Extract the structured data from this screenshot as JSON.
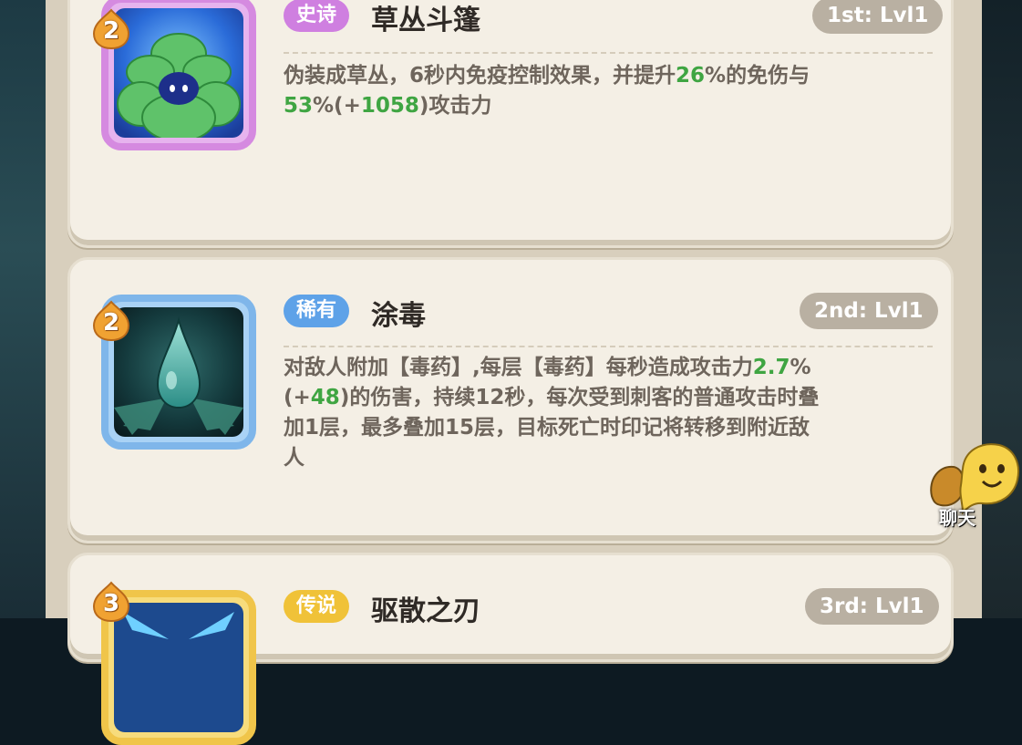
{
  "cards": [
    {
      "rarity": "史诗",
      "name": "草丛斗篷",
      "level_label": "1st: Lvl1",
      "badge": "2",
      "icon": "bush-cloak-icon",
      "desc_lines": [
        [
          {
            "t": "伪装成草丛，6秒内免疫控制效果，并提升"
          },
          {
            "t": "26",
            "g": true
          },
          {
            "t": "%的免伤与"
          }
        ],
        [
          {
            "t": "53",
            "g": true
          },
          {
            "t": "%(+"
          },
          {
            "t": "1058",
            "g": true
          },
          {
            "t": ")攻击力"
          }
        ]
      ]
    },
    {
      "rarity": "稀有",
      "name": "涂毒",
      "level_label": "2nd: Lvl1",
      "badge": "2",
      "icon": "poison-drop-icon",
      "desc_lines": [
        [
          {
            "t": "对敌人附加【毒药】,每层【毒药】每秒造成攻击力"
          },
          {
            "t": "2.7",
            "g": true
          },
          {
            "t": "%"
          }
        ],
        [
          {
            "t": "(+"
          },
          {
            "t": "48",
            "g": true
          },
          {
            "t": ")的伤害，持续12秒，每次受到刺客的普通攻击时叠"
          }
        ],
        [
          {
            "t": "加1层，最多叠加15层，目标死亡时印记将转移到附近敌"
          }
        ],
        [
          {
            "t": "人"
          }
        ]
      ]
    },
    {
      "rarity": "传说",
      "name": "驱散之刃",
      "level_label": "3rd: Lvl1",
      "badge": "3",
      "icon": "dispel-blade-icon"
    }
  ],
  "chat": {
    "label": "聊天",
    "icon": "chat-blob-icon"
  },
  "colors": {
    "epic": "#cf7fe0",
    "rare": "#5ea2e8",
    "legend": "#f0c238",
    "highlight": "#3fa542"
  }
}
